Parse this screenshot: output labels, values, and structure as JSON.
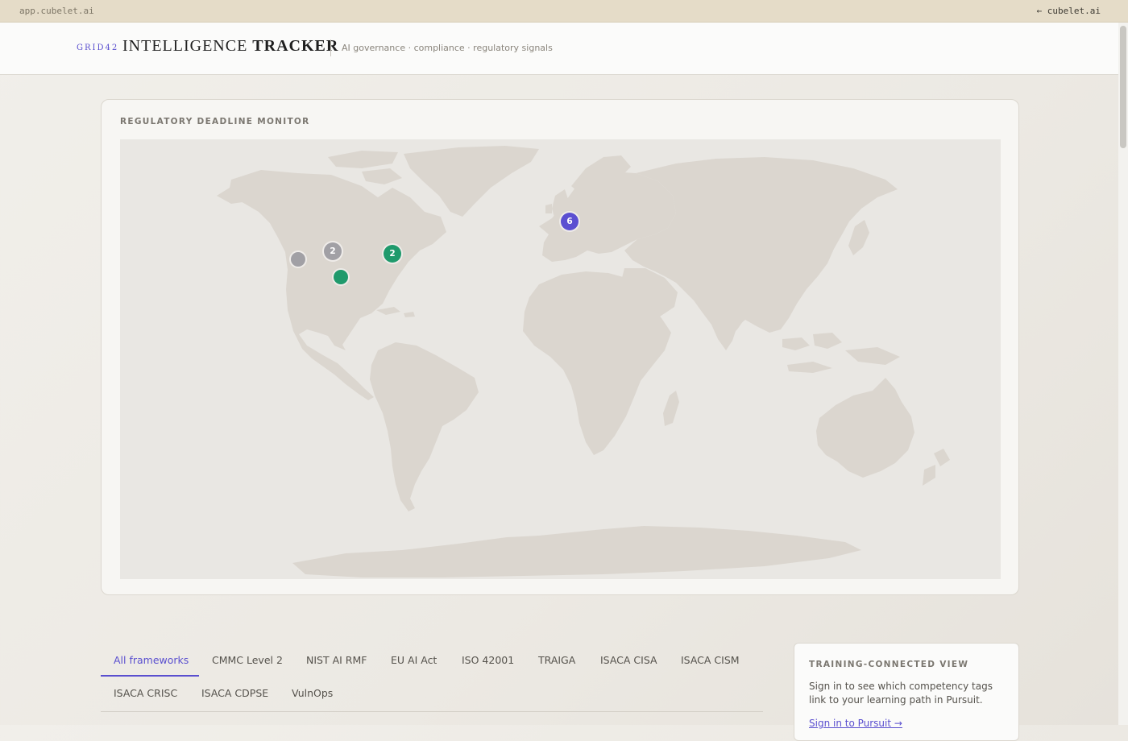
{
  "topbar": {
    "host": "app.cubelet.ai",
    "back_link": "← cubelet.ai"
  },
  "header": {
    "brand": "GRID42",
    "title_light": "INTELLIGENCE",
    "title_bold": "TRACKER",
    "subtitle": "AI governance · compliance · regulatory signals"
  },
  "map_card": {
    "title": "REGULATORY DEADLINE MONITOR",
    "markers": [
      {
        "label": "6",
        "color": "#5b4fd1"
      },
      {
        "label": "2",
        "color": "#a1a0a5"
      },
      {
        "label": "2",
        "color": "#1f9a6c"
      },
      {
        "label": "",
        "color": "#a1a0a5"
      },
      {
        "label": "",
        "color": "#1f9a6c"
      }
    ]
  },
  "tabs": [
    {
      "label": "All frameworks",
      "active": true
    },
    {
      "label": "CMMC Level 2"
    },
    {
      "label": "NIST AI RMF"
    },
    {
      "label": "EU AI Act"
    },
    {
      "label": "ISO 42001"
    },
    {
      "label": "TRAIGA"
    },
    {
      "label": "ISACA CISA"
    },
    {
      "label": "ISACA CISM"
    },
    {
      "label": "ISACA CRISC"
    },
    {
      "label": "ISACA CDPSE"
    },
    {
      "label": "VulnOps"
    }
  ],
  "side_card": {
    "title": "TRAINING-CONNECTED VIEW",
    "text": "Sign in to see which competency tags link to your learning path in Pursuit.",
    "link": "Sign in to Pursuit →"
  },
  "colors": {
    "accent": "#5a4fcf",
    "land": "#dbd6cf",
    "ocean": "#e9e7e3"
  }
}
